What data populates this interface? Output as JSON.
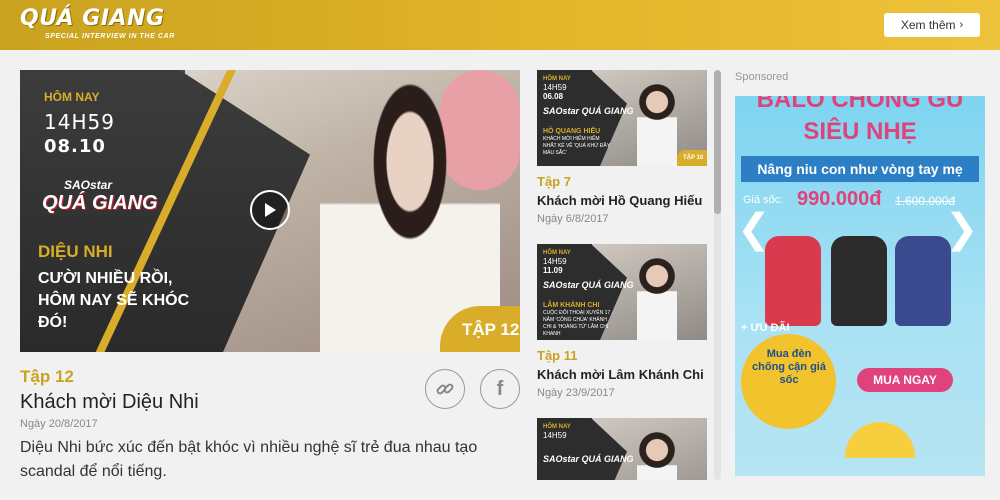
{
  "header": {
    "logo": "QUÁ GIANG",
    "logo_tagline": "SPECIAL INTERVIEW IN THE CAR",
    "see_more_label": "Xem thêm"
  },
  "featured": {
    "thumbnail": {
      "date_label": "HÔM NAY",
      "time": "14H59",
      "day": "08.10",
      "brand_top": "SAOstar",
      "brand_main": "QUÁ GIANG",
      "guest": "DIỆU NHI",
      "quote": "CƯỜI NHIỀU RỒI, HÔM NAY SẼ KHÓC ĐÓ!",
      "badge": "TẬP 12"
    },
    "episode": "Tập 12",
    "title": "Khách mời Diệu Nhi",
    "date": "Ngày 20/8/2017",
    "description": "Diệu Nhi bức xúc đến bật khóc vì nhiều nghệ sĩ trẻ đua nhau tạo scandal để nổi tiếng."
  },
  "episodes": [
    {
      "thumb": {
        "label": "HÔM NAY",
        "time": "14H59",
        "day": "06.08",
        "brand": "SAOstar QUÁ GIANG",
        "guest": "HỒ QUANG HIẾU",
        "subtitle": "KHÁCH MỜI HIẾM HIẾM NHẤT KỂ VỀ 'QUÁ KHỨ ĐẦY MÀU SẮC'",
        "badge": "TẬP 10"
      },
      "episode": "Tập 7",
      "title": "Khách mời Hồ Quang Hiếu",
      "date": "Ngày 6/8/2017"
    },
    {
      "thumb": {
        "label": "HÔM NAY",
        "time": "14H59",
        "day": "11.09",
        "brand": "SAOstar QUÁ GIANG",
        "guest": "LÂM KHÁNH CHI",
        "subtitle": "CUỘC ĐỐI THOẠI XUYÊN 17 NĂM 'CÔNG CHÚA' KHÁNH CHI & 'HOÀNG TỬ' LÂM CHÍ KHANH",
        "badge": ""
      },
      "episode": "Tập 11",
      "title": "Khách mời Lâm Khánh Chi",
      "date": "Ngày 23/9/2017"
    },
    {
      "thumb": {
        "label": "HÔM NAY",
        "time": "14H59",
        "day": "",
        "brand": "SAOstar QUÁ GIANG",
        "guest": "",
        "subtitle": "",
        "badge": ""
      },
      "episode": "",
      "title": "",
      "date": ""
    }
  ],
  "sponsored": {
    "label": "Sponsored",
    "ad": {
      "headline_1": "BALO CHỐNG GÙ",
      "headline_2": "SIÊU NHẸ",
      "tagline": "Nâng niu con như vòng tay mẹ",
      "price_label": "Giá sốc:",
      "price": "990.000đ",
      "old_price": "1.600.000đ",
      "deal": "+ ƯU ĐÃI",
      "lamp_text": "Mua đèn chống cận giá sốc",
      "buy_label": "MUA NGAY"
    }
  },
  "colors": {
    "accent_gold": "#c9a21f",
    "ad_pink": "#e0427b",
    "ad_blue": "#2d7fc5"
  }
}
